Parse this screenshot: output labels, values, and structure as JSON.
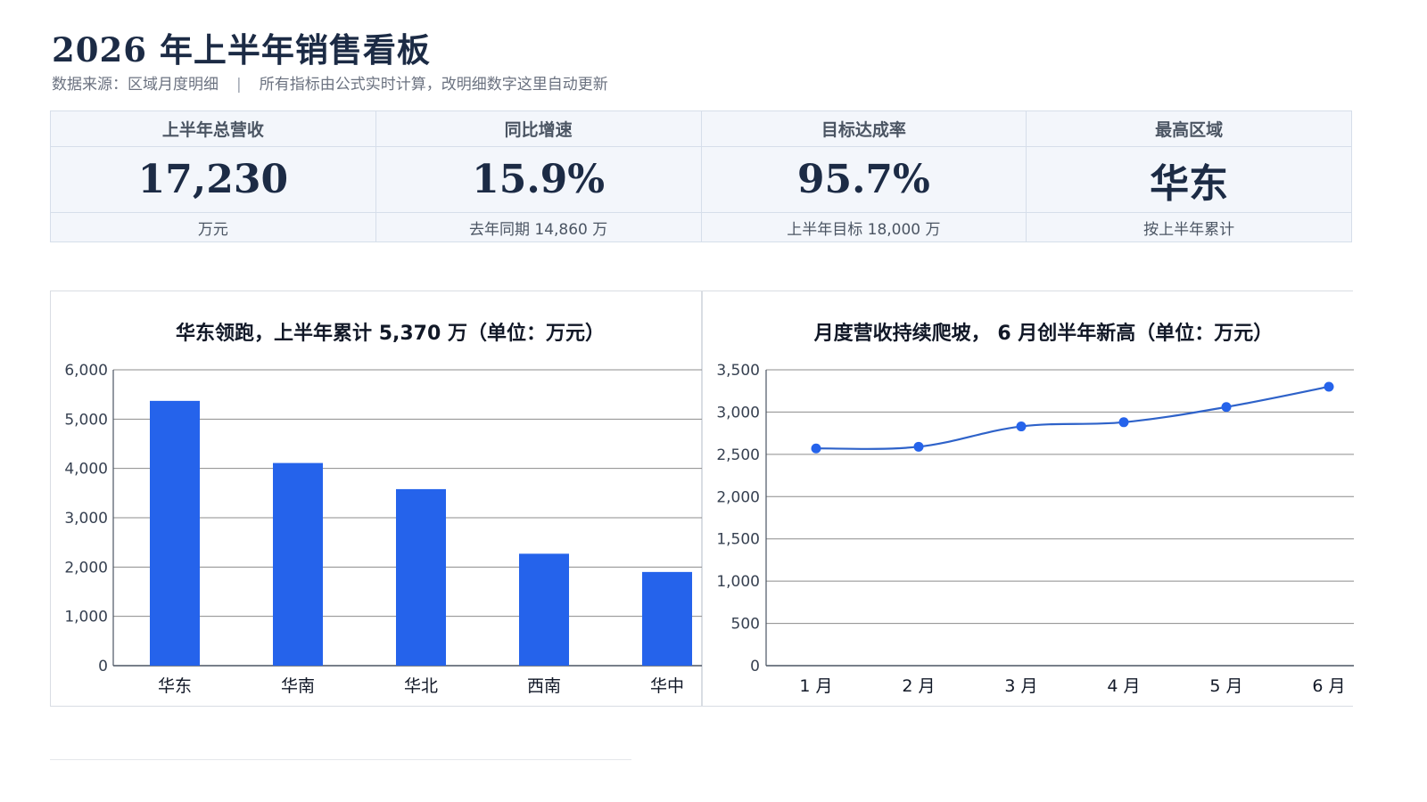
{
  "header": {
    "title": "2026 年上半年销售看板",
    "source": "数据来源：区域月度明细",
    "separator": "|",
    "note": "所有指标由公式实时计算，改明细数字这里自动更新"
  },
  "kpis": [
    {
      "label": "上半年总营收",
      "value": "17,230",
      "note": "万元"
    },
    {
      "label": "同比增速",
      "value": "15.9%",
      "note": "去年同期 14,860 万"
    },
    {
      "label": "目标达成率",
      "value": "95.7%",
      "note": "上半年目标 18,000 万"
    },
    {
      "label": "最高区域",
      "value": "华东",
      "note": "按上半年累计"
    }
  ],
  "colors": {
    "accent": "#2563eb",
    "line": "#2e62c9",
    "grid": "#8c8c8c",
    "title": "#1c2b45"
  },
  "chart_data": [
    {
      "type": "bar",
      "title": "华东领跑，上半年累计  5,370  万（单位：万元）",
      "categories": [
        "华东",
        "华南",
        "华北",
        "西南",
        "华中"
      ],
      "series": [
        {
          "values": [
            5370,
            4110,
            3580,
            2270,
            1900
          ]
        }
      ],
      "ylim": [
        0,
        6000
      ],
      "yticks": [
        0,
        1000,
        2000,
        3000,
        4000,
        5000,
        6000
      ],
      "ytick_labels": [
        "0",
        "1,000",
        "2,000",
        "3,000",
        "4,000",
        "5,000",
        "6,000"
      ],
      "grid": true,
      "legend": "none"
    },
    {
      "type": "line",
      "title": "月度营收持续爬坡， 6 月创半年新高（单位：万元）",
      "categories": [
        "1 月",
        "2 月",
        "3 月",
        "4 月",
        "5 月",
        "6 月"
      ],
      "series": [
        {
          "values": [
            2570,
            2590,
            2830,
            2880,
            3060,
            3300
          ]
        }
      ],
      "ylim": [
        0,
        3500
      ],
      "yticks": [
        0,
        500,
        1000,
        1500,
        2000,
        2500,
        3000,
        3500
      ],
      "ytick_labels": [
        "0",
        "500",
        "1,000",
        "1,500",
        "2,000",
        "2,500",
        "3,000",
        "3,500"
      ],
      "grid": true,
      "smooth": true,
      "legend": "none"
    }
  ]
}
